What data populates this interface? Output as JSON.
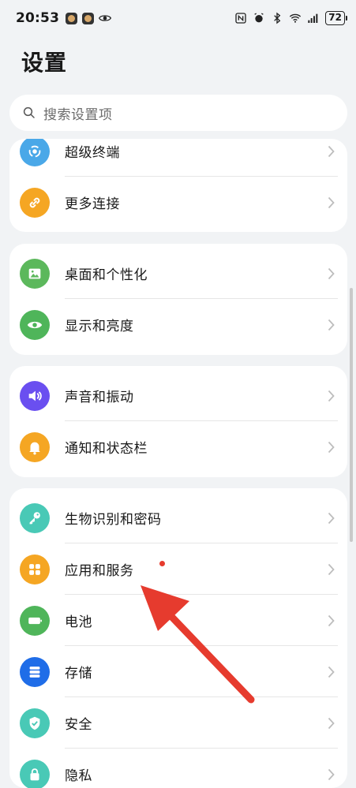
{
  "status_bar": {
    "time": "20:53",
    "battery": "72"
  },
  "page": {
    "title": "设置"
  },
  "search": {
    "placeholder": "搜索设置项"
  },
  "groups": [
    {
      "items": [
        {
          "label": "超级终端",
          "icon": "super-device-icon",
          "color": "#4aa8e8"
        },
        {
          "label": "更多连接",
          "icon": "link-icon",
          "color": "#f5a623"
        }
      ]
    },
    {
      "items": [
        {
          "label": "桌面和个性化",
          "icon": "picture-icon",
          "color": "#5cb85c"
        },
        {
          "label": "显示和亮度",
          "icon": "eye-icon",
          "color": "#4fb55a"
        }
      ]
    },
    {
      "items": [
        {
          "label": "声音和振动",
          "icon": "speaker-icon",
          "color": "#6a4ff0"
        },
        {
          "label": "通知和状态栏",
          "icon": "bell-icon",
          "color": "#f5a623"
        }
      ]
    },
    {
      "items": [
        {
          "label": "生物识别和密码",
          "icon": "key-icon",
          "color": "#49c9b6"
        },
        {
          "label": "应用和服务",
          "icon": "apps-icon",
          "color": "#f5a623"
        },
        {
          "label": "电池",
          "icon": "battery-icon",
          "color": "#4fb55a"
        },
        {
          "label": "存储",
          "icon": "storage-icon",
          "color": "#1f6de8"
        },
        {
          "label": "安全",
          "icon": "shield-icon",
          "color": "#49c9b6"
        },
        {
          "label": "隐私",
          "icon": "privacy-icon",
          "color": "#49c9b6"
        }
      ]
    }
  ],
  "colors": {
    "background": "#f1f3f5",
    "card": "#ffffff",
    "accent_arrow": "#e63b2e"
  }
}
